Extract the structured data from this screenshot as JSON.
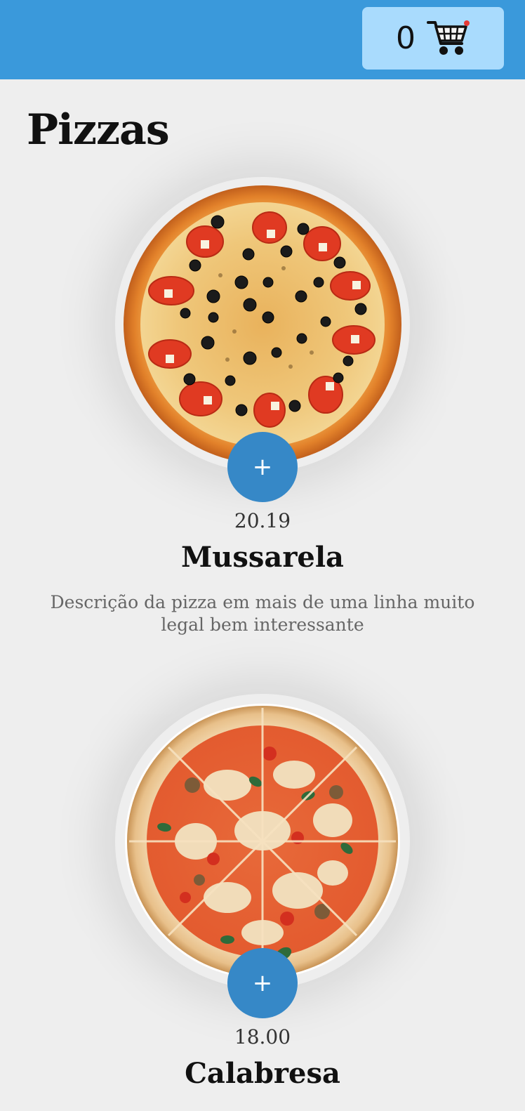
{
  "header": {
    "cart_count": "0",
    "cart_icon": "shopping-cart-icon",
    "color": "#3a99db",
    "cart_bg": "#a9dbfd"
  },
  "page": {
    "title": "Pizzas"
  },
  "pizzas": [
    {
      "price": "20.19",
      "name": "Mussarela",
      "description": "Descrição da pizza em mais de uma linha muito legal bem interessante",
      "add_label": "+",
      "image": "pizza-olive-tomato-image"
    },
    {
      "price": "18.00",
      "name": "Calabresa",
      "add_label": "+",
      "image": "pizza-vegetable-image"
    }
  ],
  "accent": "#3688c7"
}
